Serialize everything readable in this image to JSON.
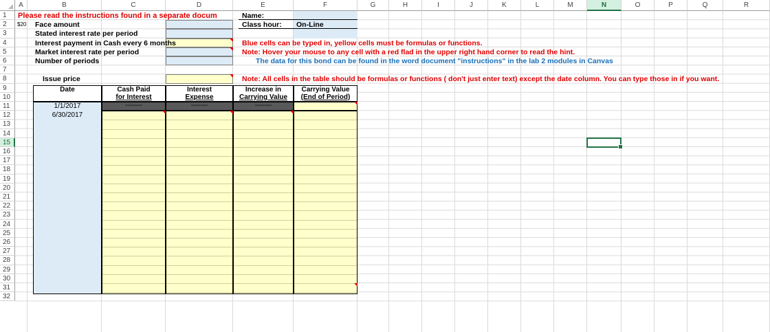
{
  "columns": [
    "A",
    "B",
    "C",
    "D",
    "E",
    "F",
    "G",
    "H",
    "I",
    "J",
    "K",
    "L",
    "M",
    "N",
    "O",
    "P",
    "Q",
    "R"
  ],
  "selected_column": "N",
  "rows": [
    "1",
    "2",
    "3",
    "4",
    "5",
    "6",
    "7",
    "8",
    "9",
    "10",
    "11",
    "12",
    "13",
    "14",
    "15",
    "16",
    "17",
    "18",
    "19",
    "20",
    "21",
    "22",
    "23",
    "24",
    "25",
    "26",
    "27",
    "28",
    "29",
    "30",
    "31",
    "32"
  ],
  "selected_row": "15",
  "header": {
    "instructions_title": "Please read the instructions found in a separate docum",
    "name_label": "Name:",
    "class_hour_label": "Class hour:",
    "class_hour_value": "On-Line"
  },
  "inputs": {
    "a2_note": "$20",
    "face_amount": "Face amount",
    "stated_rate": "Stated interest rate per period",
    "interest_payment": "Interest payment in Cash every 6 months",
    "market_rate": "Market interest rate per period",
    "num_periods": "Number of periods",
    "issue_price": "Issue price"
  },
  "notes": {
    "cells_note": "Blue cells can be typed in, yellow cells must be formulas or functions.",
    "hover_note": "Note: Hover your mouse to any cell with a red flad in the upper right hand corner to read the hint.",
    "data_note": "The data for this bond can be found in the word document \"instructions\" in the lab 2 modules in Canvas",
    "table_note": "Note: All cells in the table should be formulas or functions ( don't just enter text) except the date column. You can type those in if you want."
  },
  "table": {
    "headers": [
      {
        "line1": "",
        "line2": "Date"
      },
      {
        "line1": "Cash Paid",
        "line2": "for Interest"
      },
      {
        "line1": "Interest",
        "line2": "Expense"
      },
      {
        "line1": "Increase in",
        "line2": "Carrying Value"
      },
      {
        "line1": "Carrying Value",
        "line2": "(End of Period)"
      }
    ],
    "dash": "-------",
    "dates": [
      "1/1/2017",
      "6/30/2017"
    ]
  },
  "colors": {
    "input_blue": "#ddebf7",
    "formula_yellow": "#ffffcc",
    "dark_header": "#595959",
    "red_text": "#e00000",
    "blue_text": "#1b70b8",
    "selection_green": "#217346"
  }
}
